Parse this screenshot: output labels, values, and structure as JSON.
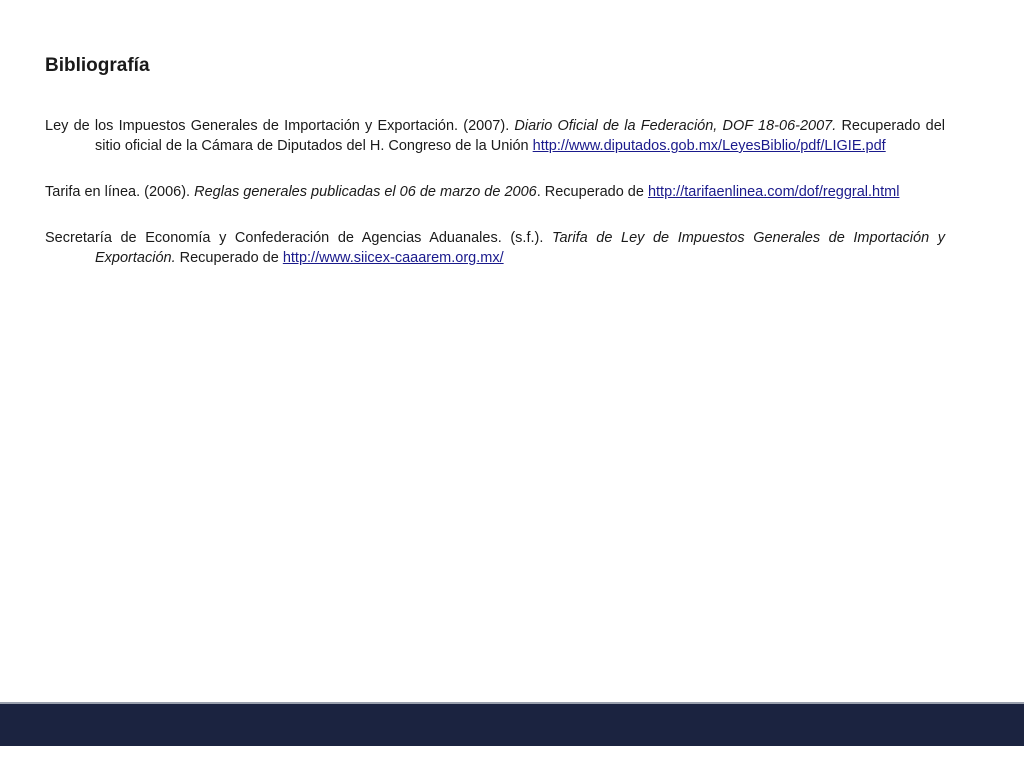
{
  "heading": "Bibliografía",
  "references": [
    {
      "pre": "Ley de los Impuestos Generales de Importación y Exportación. (2007). ",
      "italic": "Diario Oficial de la Federación, DOF 18-06-2007.",
      "post": " Recuperado del sitio oficial de la Cámara de Diputados del H. Congreso de la Unión ",
      "link": "http://www.diputados.gob.mx/LeyesBiblio/pdf/LIGIE.pdf"
    },
    {
      "pre": "Tarifa en línea. (2006). ",
      "italic": "Reglas generales publicadas el 06 de marzo de 2006",
      "post": ". Recuperado de ",
      "link": "http://tarifaenlinea.com/dof/reggral.html"
    },
    {
      "pre": "Secretaría de Economía y Confederación de Agencias Aduanales. (s.f.). ",
      "italic": "Tarifa de Ley de Impuestos Generales de Importación y Exportación.",
      "post": " Recuperado de ",
      "link": "http://www.siicex-caaarem.org.mx/"
    }
  ],
  "colors": {
    "footer_bar": "#1b2340",
    "link": "#1a1a8c"
  }
}
